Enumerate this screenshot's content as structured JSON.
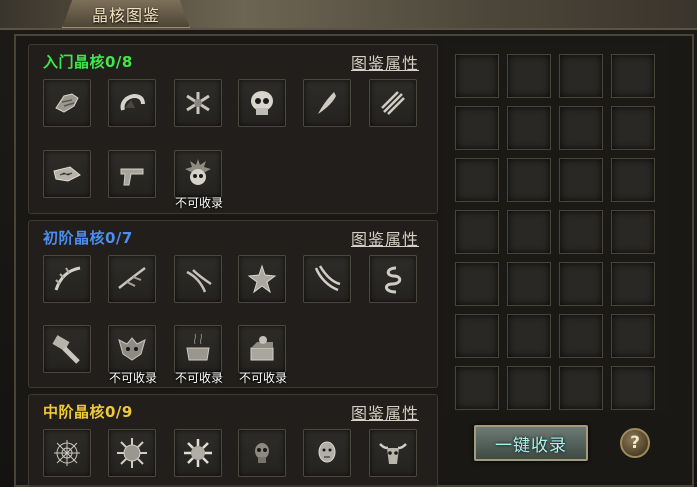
{
  "window": {
    "title": "晶核图鉴"
  },
  "sections": [
    {
      "title": "入门晶核0/8",
      "title_color": "#3ee84a",
      "link": "图鉴属性",
      "items": [
        {
          "icon": "gauntlet-icon",
          "label": ""
        },
        {
          "icon": "horn-ring-icon",
          "label": ""
        },
        {
          "icon": "bone-pile-icon",
          "label": ""
        },
        {
          "icon": "skull-icon",
          "label": ""
        },
        {
          "icon": "fang-icon",
          "label": ""
        },
        {
          "icon": "claw-icon",
          "label": ""
        },
        {
          "icon": "beast-jaw-icon",
          "label": ""
        },
        {
          "icon": "pistol-icon",
          "label": ""
        },
        {
          "icon": "spiked-skull-icon",
          "label": "不可收录"
        }
      ]
    },
    {
      "title": "初阶晶核0/7",
      "title_color": "#4c8df0",
      "link": "图鉴属性",
      "items": [
        {
          "icon": "spine-icon",
          "label": ""
        },
        {
          "icon": "bone-claw-icon",
          "label": ""
        },
        {
          "icon": "talon-icon",
          "label": ""
        },
        {
          "icon": "star-creature-icon",
          "label": ""
        },
        {
          "icon": "twin-tusk-icon",
          "label": ""
        },
        {
          "icon": "coil-icon",
          "label": ""
        },
        {
          "icon": "hammer-icon",
          "label": ""
        },
        {
          "icon": "demon-mask-icon",
          "label": "不可收录"
        },
        {
          "icon": "cauldron-icon",
          "label": "不可收录"
        },
        {
          "icon": "chest-icon",
          "label": "不可收录"
        }
      ]
    },
    {
      "title": "中阶晶核0/9",
      "title_color": "#f0c83a",
      "link": "图鉴属性",
      "items": [
        {
          "icon": "web-icon",
          "label": ""
        },
        {
          "icon": "spiked-orb-icon",
          "label": ""
        },
        {
          "icon": "spiked-orb-2-icon",
          "label": ""
        },
        {
          "icon": "small-skull-icon",
          "label": ""
        },
        {
          "icon": "head-icon",
          "label": ""
        },
        {
          "icon": "bull-skull-icon",
          "label": ""
        }
      ]
    }
  ],
  "slots": {
    "rows": 7,
    "cols": 4
  },
  "buttons": {
    "collect_all": "一键收录",
    "help": "?"
  }
}
